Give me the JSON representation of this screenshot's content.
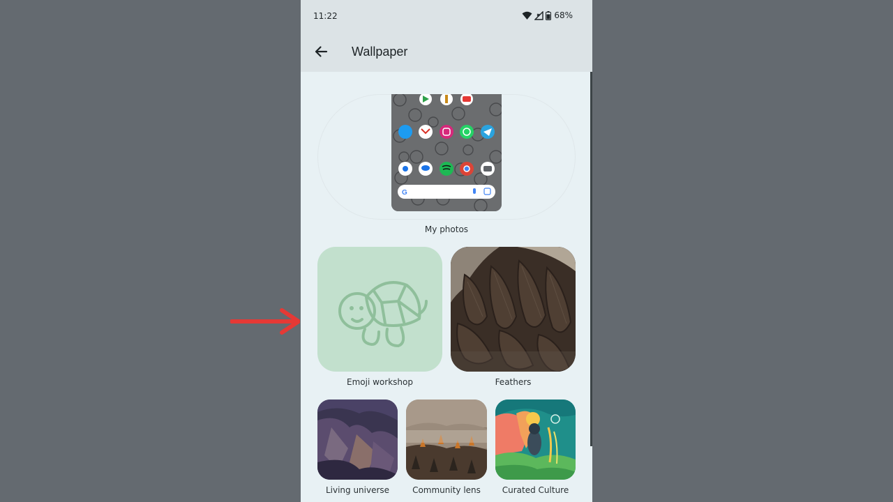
{
  "status_bar": {
    "time": "11:22",
    "battery": "68%"
  },
  "app_bar": {
    "title": "Wallpaper"
  },
  "current_wallpaper": {
    "label": "My photos"
  },
  "collections": [
    {
      "label": "Emoji workshop"
    },
    {
      "label": "Feathers"
    },
    {
      "label": "Living universe"
    },
    {
      "label": "Community lens"
    },
    {
      "label": "Curated Culture"
    }
  ],
  "icons": [
    "wifi-icon",
    "signal-icon",
    "battery-icon",
    "back-arrow-icon",
    "turtle-icon",
    "pointer-arrow-icon"
  ],
  "colors": {
    "accent_arrow": "#e53935",
    "emoji_tile": "#c2e0cd",
    "turtle_stroke": "#8fbf9b"
  }
}
